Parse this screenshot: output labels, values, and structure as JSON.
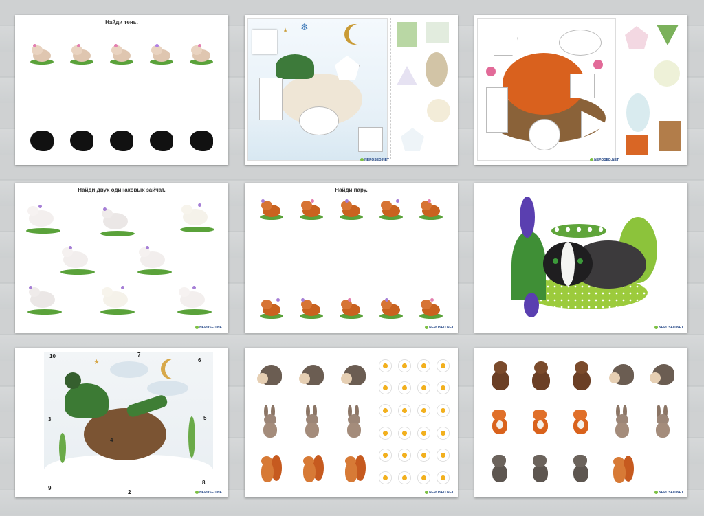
{
  "cards": {
    "shadow": {
      "title": "Найди тень.",
      "watermark": ""
    },
    "bear_puzzle": {
      "watermark": "NEPOSED.NET"
    },
    "squirrel_puzzle": {
      "watermark": "NEPOSED.NET"
    },
    "rabbits": {
      "title": "Найди двух одинаковых зайчат.",
      "watermark": "NEPOSED.NET"
    },
    "pairs": {
      "title": "Найди пару.",
      "watermark": "NEPOSED.NET"
    },
    "badger": {
      "watermark": "NEPOSED.NET"
    },
    "numbered_puzzle": {
      "watermark": "NEPOSED.NET",
      "numbers": [
        "10",
        "7",
        "6",
        "3",
        "5",
        "4",
        "9",
        "2",
        "8"
      ]
    },
    "counting_cards": {
      "watermark": "NEPOSED.NET"
    },
    "forest_animals": {
      "watermark": "NEPOSED.NET"
    }
  },
  "colors": {
    "background": "#cfd1d2",
    "card": "#ffffff",
    "watermark": "#2a4c8a",
    "leaf": "#5aa23a"
  },
  "icons": [
    "mouse-icon",
    "shadow-icon",
    "bear-icon",
    "squirrel-icon",
    "rabbit-icon",
    "badger-icon",
    "hedgehog-icon",
    "daisy-icon",
    "fox-icon",
    "wolf-icon",
    "star-icon",
    "moon-icon",
    "snowflake-icon"
  ]
}
